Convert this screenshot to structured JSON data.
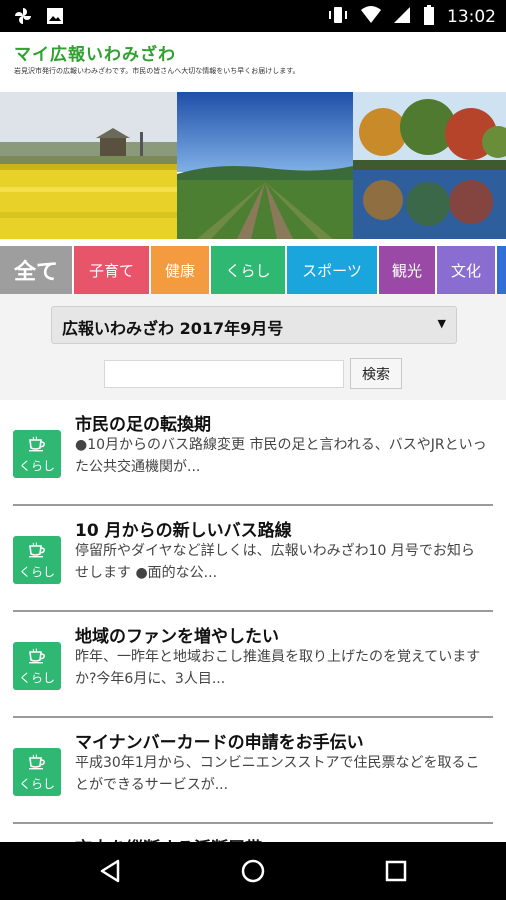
{
  "status_bar": {
    "time": "13:02"
  },
  "header": {
    "title": "マイ広報いわみざわ",
    "tagline": "岩見沢市発行の広報いわみざわです。市民の皆さんへ大切な情報をいち早くお届けします。"
  },
  "categories": [
    {
      "label": "全て",
      "color": "#9e9e9e"
    },
    {
      "label": "子育て",
      "color": "#e8546a"
    },
    {
      "label": "健康",
      "color": "#f49a3f"
    },
    {
      "label": "くらし",
      "color": "#2eb872"
    },
    {
      "label": "スポーツ",
      "color": "#1aa6dd"
    },
    {
      "label": "観光",
      "color": "#9a4aa6"
    },
    {
      "label": "文化",
      "color": "#8a6dd0"
    },
    {
      "label": "",
      "color": "#2f6fd6"
    }
  ],
  "filter": {
    "issue_selected": "広報いわみざわ 2017年9月号",
    "search_placeholder": "",
    "search_button": "検索"
  },
  "articles": [
    {
      "category": "くらし",
      "title": "市民の足の転換期",
      "desc": "●10月からのバス路線変更 市民の足と言われる、バスやJRといった公共交通機関が..."
    },
    {
      "category": "くらし",
      "title": "10 月からの新しいバス路線",
      "desc": "停留所やダイヤなど詳しくは、広報いわみざわ10 月号でお知らせします ●面的な公..."
    },
    {
      "category": "くらし",
      "title": "地域のファンを増やしたい",
      "desc": "昨年、一昨年と地域おこし推進員を取り上げたのを覚えていますか?今年6月に、3人目..."
    },
    {
      "category": "くらし",
      "title": "マイナンバーカードの申請をお手伝い",
      "desc": "平成30年1月から、コンビニエンスストアで住民票などを取ることができるサービスが..."
    },
    {
      "category": "くらし",
      "title": "市内を縦断する活断層帯",
      "desc": ""
    }
  ],
  "colors": {
    "brand_green": "#2ea12e",
    "kurashi_green": "#2eb872"
  },
  "icons": [
    "pinwheel-icon",
    "image-icon",
    "vibrate-icon",
    "wifi-icon",
    "signal-icon",
    "battery-icon",
    "coffee-cup-icon",
    "back-icon",
    "home-icon",
    "recents-icon"
  ]
}
